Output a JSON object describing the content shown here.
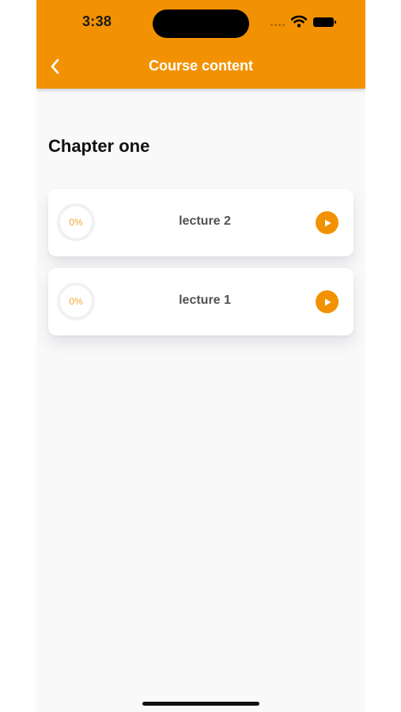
{
  "status_bar": {
    "time": "3:38"
  },
  "header": {
    "title": "Course content",
    "back_icon": "chevron-left-icon",
    "background_color": "#f29202"
  },
  "chapter": {
    "title": "Chapter one",
    "lectures": [
      {
        "name": "lecture 2",
        "progress_label": "0%",
        "progress": 0
      },
      {
        "name": "lecture 1",
        "progress_label": "0%",
        "progress": 0
      }
    ]
  },
  "colors": {
    "accent": "#f29202",
    "progress_text": "#f2a73a",
    "background": "#f9f9fa"
  }
}
